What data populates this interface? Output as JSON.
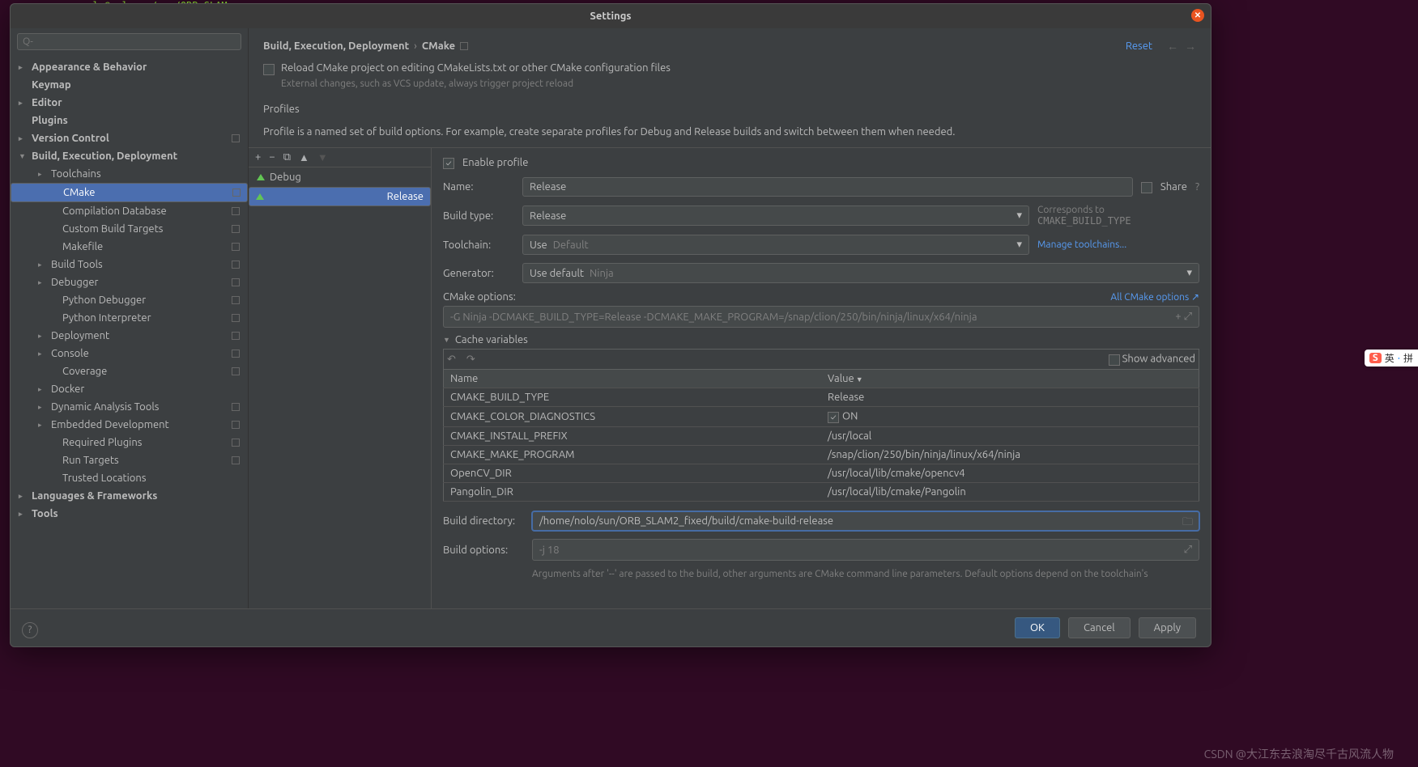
{
  "terminal_prompt": "nolo@nolo: ~/sun/ORB_SLAM",
  "dialog": {
    "title": "Settings"
  },
  "search": {
    "placeholder": "Q-"
  },
  "tree": [
    {
      "label": "Appearance & Behavior",
      "lvl": 0,
      "exp": true
    },
    {
      "label": "Keymap",
      "lvl": 0,
      "exp": false,
      "noarrow": true
    },
    {
      "label": "Editor",
      "lvl": 0,
      "exp": true
    },
    {
      "label": "Plugins",
      "lvl": 0,
      "exp": false,
      "noarrow": true
    },
    {
      "label": "Version Control",
      "lvl": 0,
      "exp": true,
      "tag": true
    },
    {
      "label": "Build, Execution, Deployment",
      "lvl": 0,
      "exp": true,
      "open": true
    },
    {
      "label": "Toolchains",
      "lvl": 1,
      "exp": true
    },
    {
      "label": "CMake",
      "lvl": 2,
      "sel": true,
      "tag": true
    },
    {
      "label": "Compilation Database",
      "lvl": 2,
      "tag": true
    },
    {
      "label": "Custom Build Targets",
      "lvl": 2,
      "tag": true
    },
    {
      "label": "Makefile",
      "lvl": 2,
      "tag": true
    },
    {
      "label": "Build Tools",
      "lvl": 1,
      "exp": true,
      "tag": true
    },
    {
      "label": "Debugger",
      "lvl": 1,
      "exp": true,
      "tag": true
    },
    {
      "label": "Python Debugger",
      "lvl": 2,
      "tag": true
    },
    {
      "label": "Python Interpreter",
      "lvl": 2,
      "tag": true
    },
    {
      "label": "Deployment",
      "lvl": 1,
      "exp": true,
      "tag": true
    },
    {
      "label": "Console",
      "lvl": 1,
      "exp": true,
      "tag": true
    },
    {
      "label": "Coverage",
      "lvl": 2,
      "tag": true
    },
    {
      "label": "Docker",
      "lvl": 1,
      "exp": true
    },
    {
      "label": "Dynamic Analysis Tools",
      "lvl": 1,
      "exp": true,
      "tag": true
    },
    {
      "label": "Embedded Development",
      "lvl": 1,
      "exp": true,
      "tag": true
    },
    {
      "label": "Required Plugins",
      "lvl": 2,
      "tag": true
    },
    {
      "label": "Run Targets",
      "lvl": 2,
      "tag": true
    },
    {
      "label": "Trusted Locations",
      "lvl": 2
    },
    {
      "label": "Languages & Frameworks",
      "lvl": 0,
      "exp": true
    },
    {
      "label": "Tools",
      "lvl": 0,
      "exp": true
    }
  ],
  "breadcrumb": {
    "a": "Build, Execution, Deployment",
    "b": "CMake",
    "reset": "Reset"
  },
  "reload": {
    "label": "Reload CMake project on editing CMakeLists.txt or other CMake configuration files",
    "hint": "External changes, such as VCS update, always trigger project reload"
  },
  "profiles_header": "Profiles",
  "profiles_desc": "Profile is a named set of build options. For example, create separate profiles for Debug and Release builds and switch between them when needed.",
  "profiles": [
    {
      "name": "Debug"
    },
    {
      "name": "Release",
      "sel": true
    }
  ],
  "form": {
    "enable": "Enable profile",
    "share": "Share",
    "name_label": "Name:",
    "name_value": "Release",
    "buildtype_label": "Build type:",
    "buildtype_value": "Release",
    "buildtype_hint_a": "Corresponds to ",
    "buildtype_hint_b": "CMAKE_BUILD_TYPE",
    "toolchain_label": "Toolchain:",
    "toolchain_use": "Use",
    "toolchain_value": "Default",
    "toolchain_link": "Manage toolchains...",
    "generator_label": "Generator:",
    "generator_use": "Use default",
    "generator_value": "Ninja",
    "cmake_opts_label": "CMake options:",
    "cmake_opts_value": "-G Ninja -DCMAKE_BUILD_TYPE=Release -DCMAKE_MAKE_PROGRAM=/snap/clion/250/bin/ninja/linux/x64/ninja",
    "cmake_opts_link": "All CMake options ↗",
    "cache_label": "Cache variables",
    "show_adv": "Show advanced",
    "th_name": "Name",
    "th_value": "Value",
    "cache": [
      {
        "name": "CMAKE_BUILD_TYPE",
        "value": "Release"
      },
      {
        "name": "CMAKE_COLOR_DIAGNOSTICS",
        "value": "ON",
        "check": true
      },
      {
        "name": "CMAKE_INSTALL_PREFIX",
        "value": "/usr/local"
      },
      {
        "name": "CMAKE_MAKE_PROGRAM",
        "value": "/snap/clion/250/bin/ninja/linux/x64/ninja"
      },
      {
        "name": "OpenCV_DIR",
        "value": "/usr/local/lib/cmake/opencv4"
      },
      {
        "name": "Pangolin_DIR",
        "value": "/usr/local/lib/cmake/Pangolin"
      }
    ],
    "builddir_label": "Build directory:",
    "builddir_value": "/home/nolo/sun/ORB_SLAM2_fixed/build/cmake-build-release",
    "buildopts_label": "Build options:",
    "buildopts_value": "-j 18",
    "buildopts_hint": "Arguments after '--' are passed to the build, other arguments are CMake command line parameters. Default options depend on the toolchain's"
  },
  "footer": {
    "ok": "OK",
    "cancel": "Cancel",
    "apply": "Apply"
  },
  "watermark": "CSDN @大江东去浪淘尽千古风流人物",
  "ime": {
    "s": "S",
    "t1": "英",
    "t2": "拼"
  }
}
